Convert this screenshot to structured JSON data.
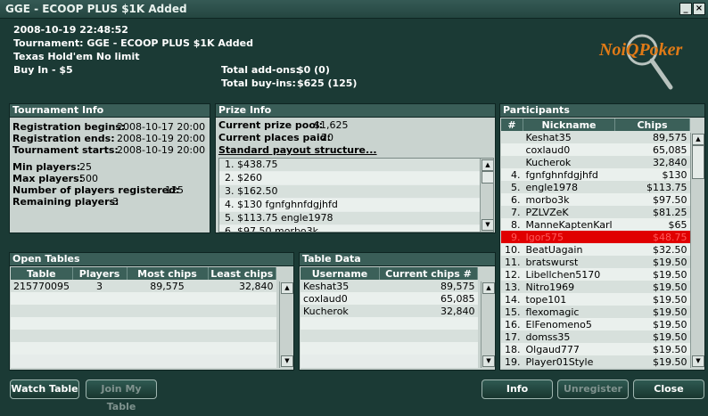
{
  "window": {
    "title": "GGE - ECOOP PLUS $1K Added"
  },
  "header": {
    "datetime": "2008-10-19 22:48:52",
    "tournament": "Tournament: GGE - ECOOP PLUS $1K Added",
    "game": "Texas Hold'em No limit",
    "buyin": "Buy In - $5",
    "addons_label": "Total add-ons:",
    "addons_value": "$0 (0)",
    "buyins_label": "Total buy-ins:",
    "buyins_value": "$625 (125)"
  },
  "logo": {
    "text": "NoiQPoker"
  },
  "tournament_info": {
    "title": "Tournament Info",
    "reg_begins_label": "Registration begins:",
    "reg_begins": "2008-10-17 20:00",
    "reg_ends_label": "Registration ends:",
    "reg_ends": "2008-10-19 20:00",
    "starts_label": "Tournament starts:",
    "starts": "2008-10-19 20:00",
    "min_label": "Min players:",
    "min": "25",
    "max_label": "Max players:",
    "max": "500",
    "registered_label": "Number of players registered:",
    "registered": "125",
    "remaining_label": "Remaining players:",
    "remaining": "3"
  },
  "prize_info": {
    "title": "Prize Info",
    "pool_label": "Current prize pool:",
    "pool": "$1,625",
    "places_label": "Current places paid:",
    "places": "20",
    "payout_link": "Standard payout structure...",
    "list": [
      "1. $438.75",
      "2. $260",
      "3. $162.50",
      "4. $130 fgnfghnfdgjhfd",
      "5. $113.75 engle1978",
      "6. $97.50 morbo3k"
    ]
  },
  "participants": {
    "title": "Participants",
    "headers": [
      "#",
      "Nickname",
      "Chips"
    ],
    "rows": [
      [
        "",
        "Keshat35",
        "89,575"
      ],
      [
        "",
        "coxlaud0",
        "65,085"
      ],
      [
        "",
        "Kucherok",
        "32,840"
      ],
      [
        "4.",
        "fgnfghnfdgjhfd",
        "$130"
      ],
      [
        "5.",
        "engle1978",
        "$113.75"
      ],
      [
        "6.",
        "morbo3k",
        "$97.50"
      ],
      [
        "7.",
        "PZLVZeK",
        "$81.25"
      ],
      [
        "8.",
        "ManneKaptenKarl",
        "$65"
      ],
      [
        "9.",
        "Igor575",
        "$48.75"
      ],
      [
        "10.",
        "BeatUagain",
        "$32.50"
      ],
      [
        "11.",
        "bratswurst",
        "$19.50"
      ],
      [
        "12.",
        "Libellchen5170",
        "$19.50"
      ],
      [
        "13.",
        "Nitro1969",
        "$19.50"
      ],
      [
        "14.",
        "tope101",
        "$19.50"
      ],
      [
        "15.",
        "flexomagic",
        "$19.50"
      ],
      [
        "16.",
        "ElFenomeno5",
        "$19.50"
      ],
      [
        "17.",
        "domss35",
        "$19.50"
      ],
      [
        "18.",
        "Olgaud777",
        "$19.50"
      ],
      [
        "19.",
        "Player01Style",
        "$19.50"
      ]
    ],
    "selected_row": 8
  },
  "open_tables": {
    "title": "Open Tables",
    "headers": [
      "Table",
      "Players",
      "Most chips",
      "Least chips"
    ],
    "rows": [
      [
        "215770095",
        "3",
        "89,575",
        "32,840"
      ]
    ]
  },
  "table_data": {
    "title": "Table Data",
    "headers": [
      "Username",
      "Current chips #"
    ],
    "rows": [
      [
        "Keshat35",
        "89,575"
      ],
      [
        "coxlaud0",
        "65,085"
      ],
      [
        "Kucherok",
        "32,840"
      ]
    ]
  },
  "buttons": {
    "watch": "Watch Table",
    "join": "Join My Table",
    "info": "Info",
    "unregister": "Unregister",
    "close": "Close"
  }
}
